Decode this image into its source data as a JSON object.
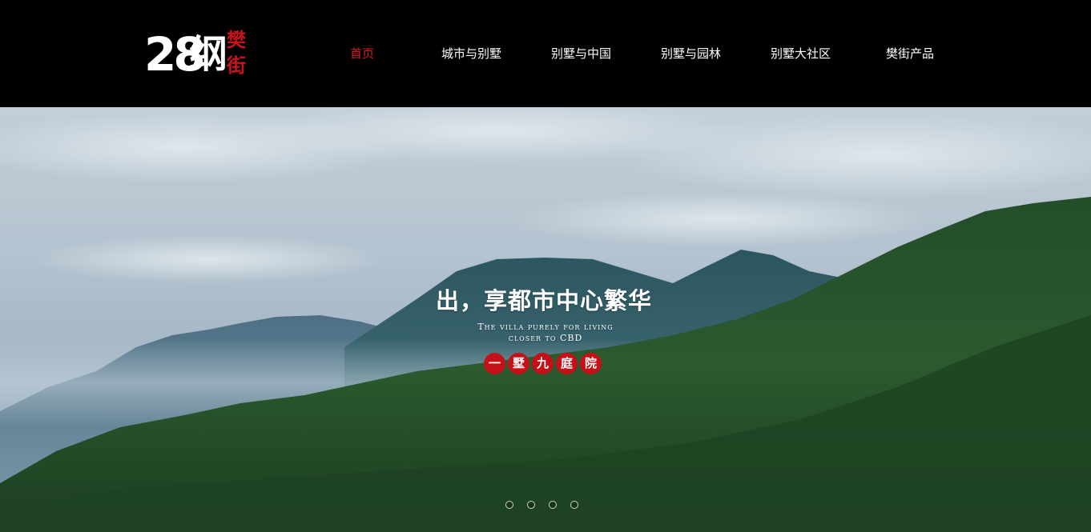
{
  "logo": {
    "number": "28",
    "char": "纲",
    "seal_chars": [
      "樊",
      "街"
    ]
  },
  "nav": {
    "items": [
      {
        "label": "首页",
        "active": true
      },
      {
        "label": "城市与别墅",
        "active": false
      },
      {
        "label": "别墅与中国",
        "active": false
      },
      {
        "label": "别墅与园林",
        "active": false
      },
      {
        "label": "别墅大社区",
        "active": false
      },
      {
        "label": "樊街产品",
        "active": false
      }
    ]
  },
  "hero": {
    "headline": "出，享都市中心繁华",
    "subtitle_line1": "The villa purely for living",
    "subtitle_line2": "closer to CBD",
    "seal_chars": [
      "一",
      "墅",
      "九",
      "庭",
      "院"
    ],
    "slide_count": 4,
    "active_slide": 1
  },
  "colors": {
    "accent_red": "#c41016",
    "nav_active": "#d91e1e",
    "header_bg": "#000000"
  }
}
